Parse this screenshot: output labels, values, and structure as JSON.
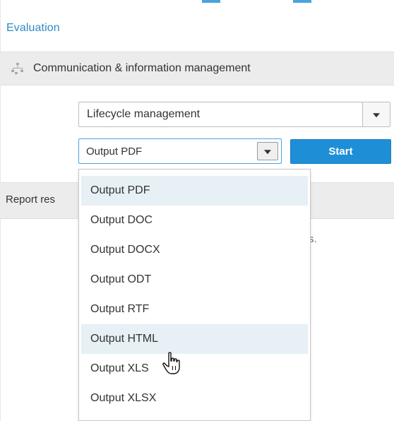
{
  "breadcrumb_title": "Evaluation",
  "section": {
    "title": "Communication & information management",
    "icon": "hierarchy-icon"
  },
  "lifecycle_select": {
    "value": "Lifecycle management"
  },
  "output_select": {
    "value": "Output PDF"
  },
  "start_button": {
    "label": "Start",
    "color": "#1e8fd6"
  },
  "report_row": {
    "label": "Report res",
    "partial_text": "s."
  },
  "dropdown": {
    "options": [
      "Output PDF",
      "Output DOC",
      "Output DOCX",
      "Output ODT",
      "Output RTF",
      "Output HTML",
      "Output XLS",
      "Output XLSX"
    ],
    "selected": "Output PDF",
    "hovered": "Output HTML"
  },
  "colors": {
    "accent": "#2f8ac6",
    "header_bg": "#ececec",
    "highlight_bg": "#e6f0f5"
  }
}
